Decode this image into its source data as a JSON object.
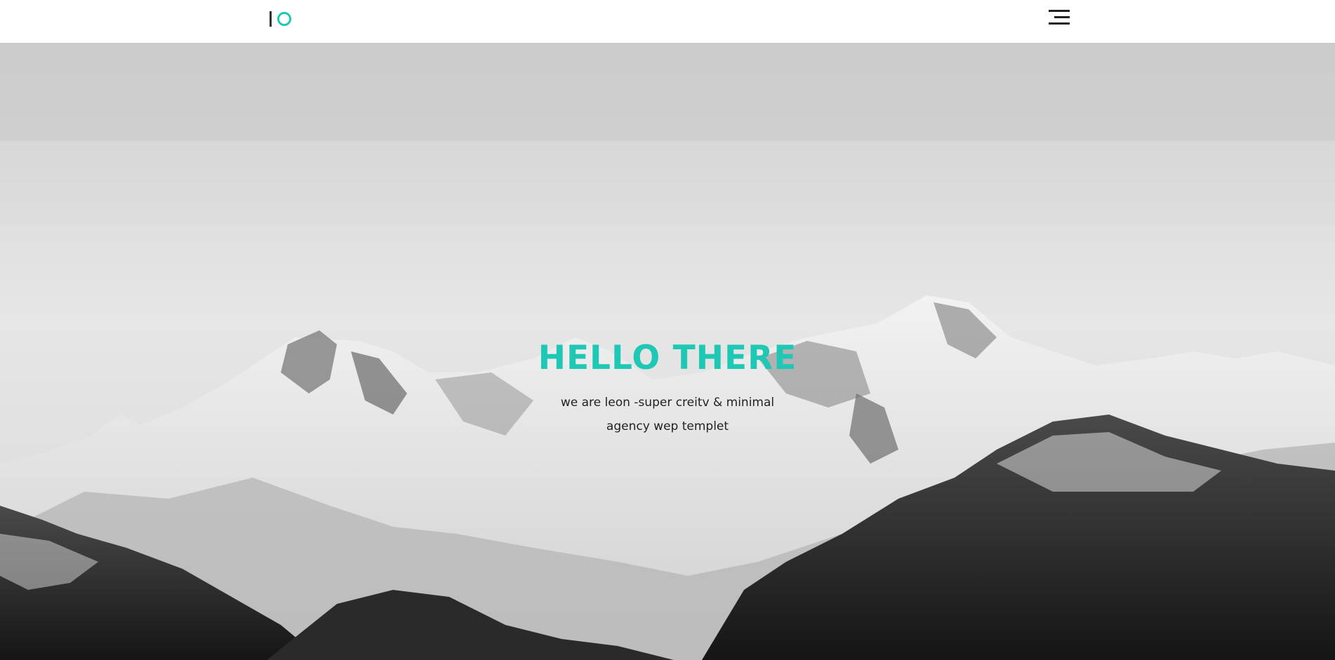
{
  "header": {
    "logo_text": "IO",
    "menu_icon": "hamburger-menu-icon",
    "accent_color": "#1ec8b4"
  },
  "hero": {
    "title": "HELLO THERE",
    "subtitle_line1": "we are leon -super creitv & minimal",
    "subtitle_line2": "agency wep templet",
    "background": "snowy-mountain-range-photo"
  }
}
